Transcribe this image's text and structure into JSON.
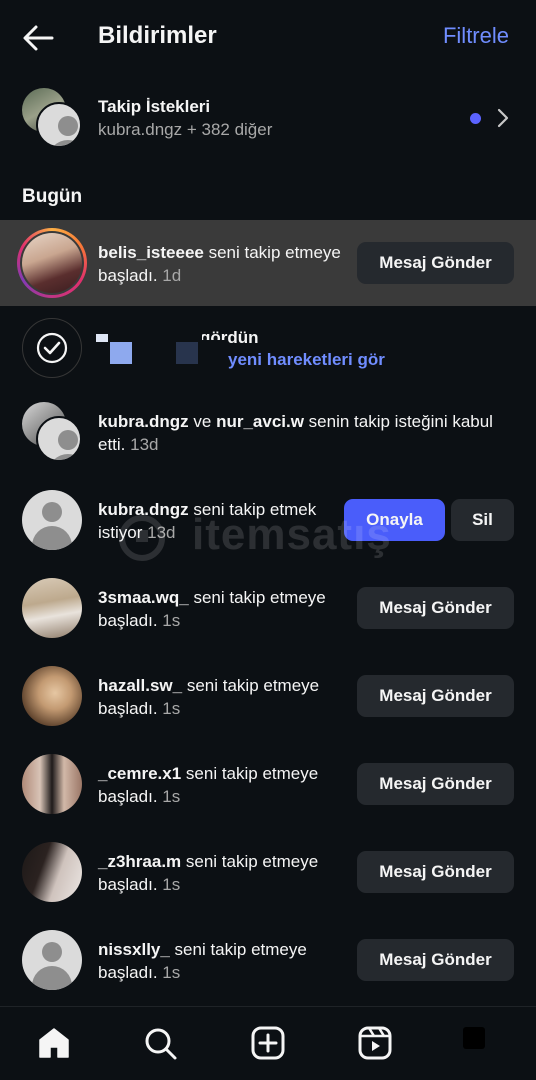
{
  "header": {
    "title": "Bildirimler",
    "filter_label": "Filtrele"
  },
  "requests": {
    "title": "Takip İstekleri",
    "subtitle": "kubra.dngz + 382 diğer"
  },
  "section_today": "Bugün",
  "notifications": [
    {
      "username": "belis_isteeee",
      "text": " seni takip etmeye başladı.",
      "time": " 1d",
      "button": "Mesaj Gönder"
    },
    {
      "title_partial": "gördün",
      "link": "yeni hareketleri gör"
    },
    {
      "username": "kubra.dngz",
      "joiner": " ve ",
      "username2": "nur_avci.w",
      "text": " senin takip isteğini kabul etti.",
      "time": " 13d"
    },
    {
      "username": "kubra.dngz",
      "text": " seni takip etmek istiyor",
      "time": " 13d",
      "approve": "Onayla",
      "delete": "Sil"
    },
    {
      "username": "3smaa.wq_",
      "text": " seni takip etmeye başladı.",
      "time": " 1s",
      "button": "Mesaj Gönder"
    },
    {
      "username": "hazall.sw_",
      "text": " seni takip etmeye başladı.",
      "time": " 1s",
      "button": "Mesaj Gönder"
    },
    {
      "username": "_cemre.x1",
      "text": " seni takip etmeye başladı.",
      "time": " 1s",
      "button": "Mesaj Gönder"
    },
    {
      "username": "_z3hraa.m",
      "text": " seni takip etmeye başladı.",
      "time": " 1s",
      "button": "Mesaj Gönder"
    },
    {
      "username": "nissxlly_",
      "text": " seni takip etmeye başladı.",
      "time": " 1s",
      "button": "Mesaj Gönder"
    }
  ],
  "watermark": "itemsatış",
  "colors": {
    "accent": "#708dff",
    "primary_button": "#4a5dfa",
    "unread_dot": "#5b63ff",
    "highlight_row": "#3a3a3a"
  },
  "nav_icons": [
    "home-icon",
    "search-icon",
    "create-icon",
    "reels-icon",
    "profile-icon"
  ]
}
